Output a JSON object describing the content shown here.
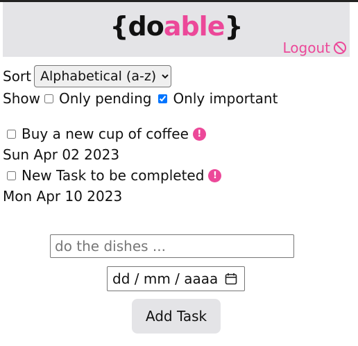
{
  "header": {
    "logo_open": "{do",
    "logo_accent": "able",
    "logo_close": "}",
    "logout_label": "Logout",
    "logout_icon": "ban-icon"
  },
  "controls": {
    "sort_label": "Sort",
    "sort_selected": "Alphabetical (a-z)",
    "show_label": "Show",
    "only_pending_label": "Only pending",
    "only_pending_checked": false,
    "only_important_label": "Only important",
    "only_important_checked": true
  },
  "tasks": [
    {
      "title": "Buy a new cup of coffee",
      "due": "Sun Apr 02 2023",
      "important": true,
      "done": false
    },
    {
      "title": "New Task to be completed",
      "due": "Mon Apr 10 2023",
      "important": true,
      "done": false
    }
  ],
  "form": {
    "task_placeholder": "do the dishes ...",
    "date_placeholder": "dd / mm / aaaa",
    "date_icon": "calendar-icon",
    "add_label": "Add Task"
  },
  "colors": {
    "accent": "#ec4899",
    "header_bg": "#e4e4e7"
  }
}
